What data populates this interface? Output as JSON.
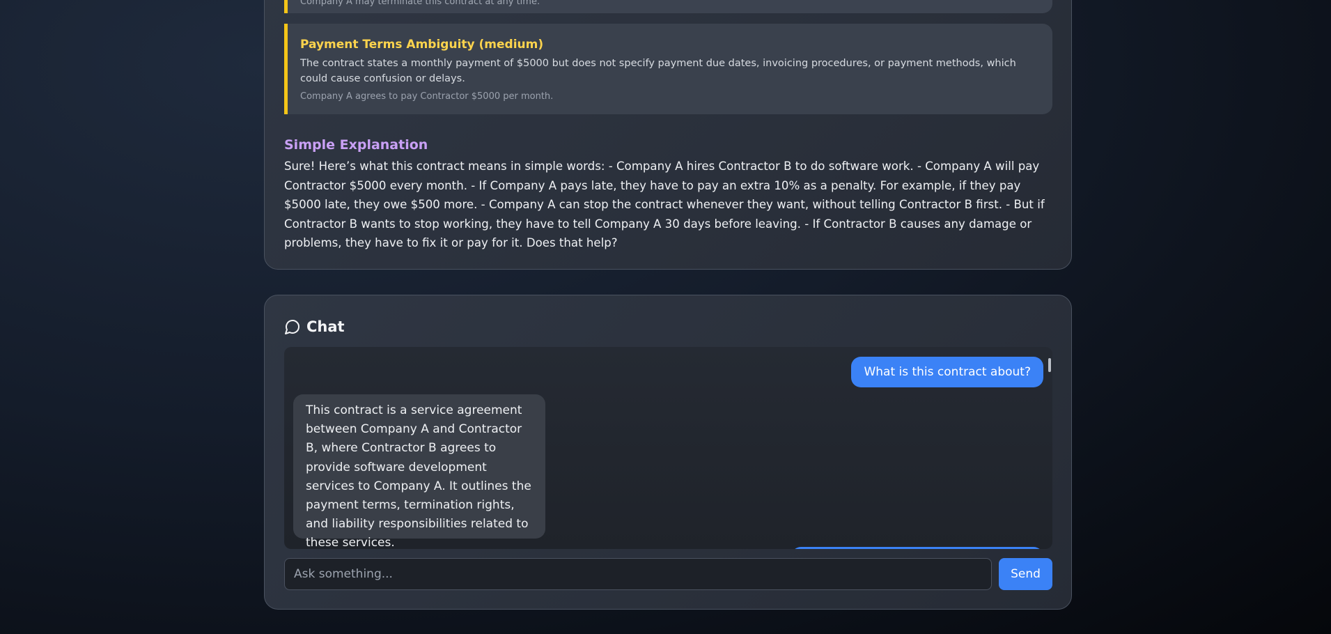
{
  "analysis": {
    "previous_issue_quote": "Company A may terminate this contract at any time.",
    "issues": [
      {
        "title": "Payment Terms Ambiguity (medium)",
        "description": "The contract states a monthly payment of $5000 but does not specify payment due dates, invoicing procedures, or payment methods, which could cause confusion or delays.",
        "quote": "Company A agrees to pay Contractor $5000 per month."
      }
    ],
    "simple_explanation": {
      "heading": "Simple Explanation",
      "body": "Sure! Here’s what this contract means in simple words: - Company A hires Contractor B to do software work. - Company A will pay Contractor $5000 every month. - If Company A pays late, they have to pay an extra 10% as a penalty. For example, if they pay $5000 late, they owe $500 more. - Company A can stop the contract whenever they want, without telling Contractor B first. - But if Contractor B wants to stop working, they have to tell Company A 30 days before leaving. - If Contractor B causes any damage or problems, they have to fix it or pay for it. Does that help?"
    }
  },
  "chat": {
    "title": "Chat",
    "icon": "chat-bubble-icon",
    "messages": [
      {
        "role": "user",
        "text": "What is this contract about?"
      },
      {
        "role": "assistant",
        "text": "This contract is a service agreement between Company A and Contractor B, where Contractor B agrees to provide software development services to Company A. It outlines the payment terms, termination rights, and liability responsibilities related to these services."
      }
    ],
    "input": {
      "value": "",
      "placeholder": "Ask something..."
    },
    "send_label": "Send"
  },
  "colors": {
    "accent": "#3b82f6",
    "warning_border": "#f5c518",
    "issue_title": "#fcd34d",
    "explanation_heading": "#c9a0f5"
  }
}
